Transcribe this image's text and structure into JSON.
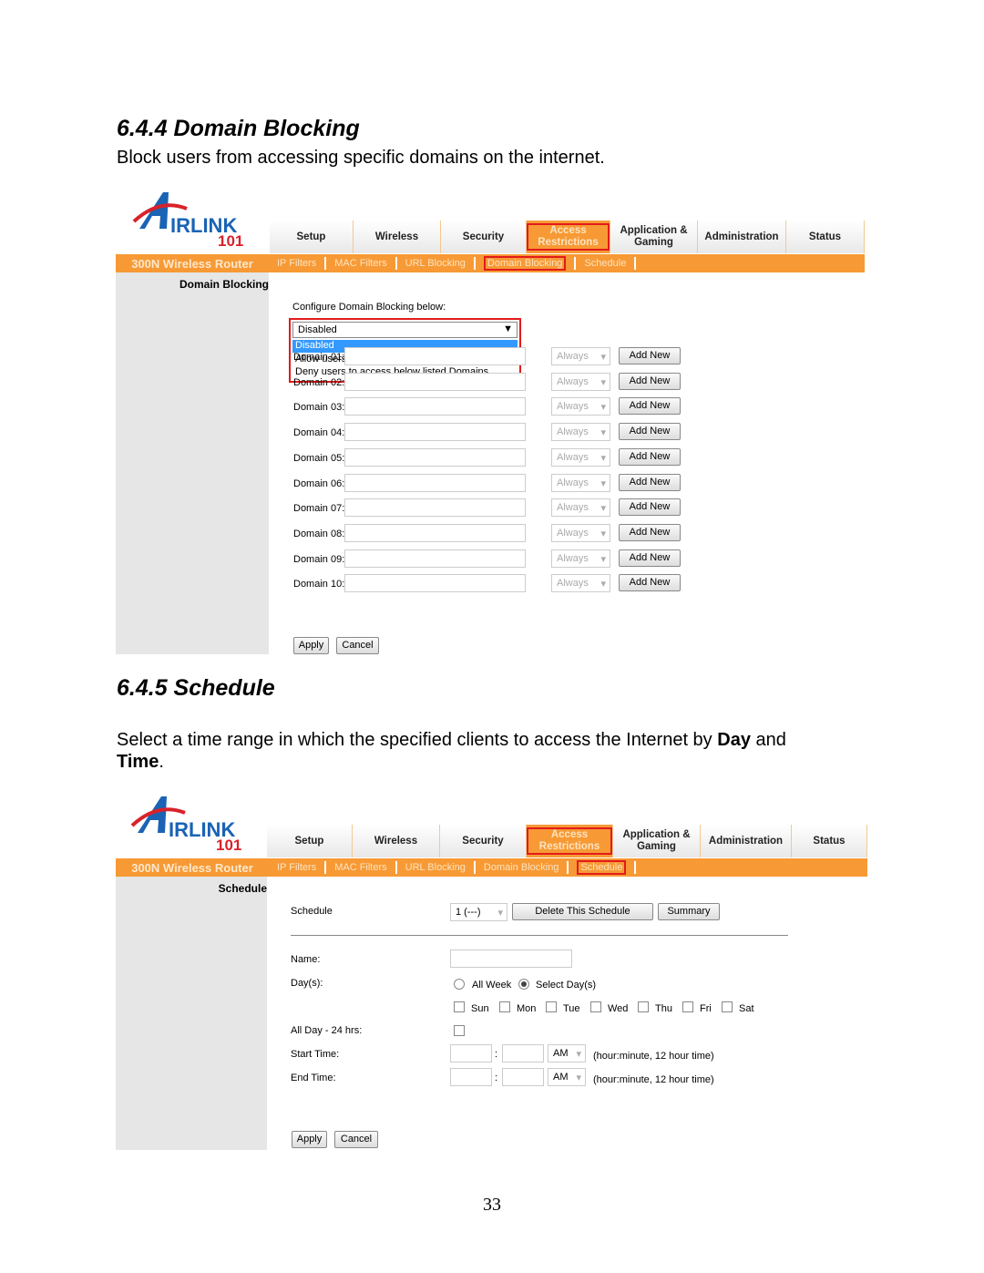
{
  "section1": {
    "title": "6.4.4 Domain Blocking",
    "description": "Block users from accessing specific domains on the internet."
  },
  "section2": {
    "title": "6.4.5 Schedule",
    "desc_a": "Select  a time range in which the specified clients to access the Internet by ",
    "desc_day": "Day",
    "desc_b": " and",
    "desc_time": "Time",
    "desc_c": "."
  },
  "logo": {
    "text": "AIRLINK 101"
  },
  "nav": {
    "tabs": [
      "Setup",
      "Wireless",
      "Security",
      "Access Restrictions",
      "Application & Gaming",
      "Administration",
      "Status"
    ],
    "active": "Access Restrictions",
    "brand": "300N Wireless Router",
    "subtabs": [
      "IP Filters",
      "MAC Filters",
      "URL Blocking",
      "Domain Blocking",
      "Schedule"
    ]
  },
  "domain": {
    "side_title": "Domain Blocking",
    "configure_label": "Configure Domain Blocking below:",
    "select_value": "Disabled",
    "options": [
      "Disabled",
      "Allow users to access below listed Domains",
      "Deny users to access below listed Domains"
    ],
    "rows": [
      "Domain 01:",
      "Domain 02:",
      "Domain 03:",
      "Domain 04:",
      "Domain 05:",
      "Domain 06:",
      "Domain 07:",
      "Domain 08:",
      "Domain 09:",
      "Domain 10:"
    ],
    "schedule_value": "Always",
    "add_new": "Add New",
    "apply": "Apply",
    "cancel": "Cancel"
  },
  "schedule": {
    "side_title": "Schedule",
    "schedule_label": "Schedule",
    "schedule_value": "1 (---)",
    "delete": "Delete This Schedule",
    "summary": "Summary",
    "name_label": "Name:",
    "days_label": "Day(s):",
    "all_week": "All Week",
    "select_days": "Select Day(s)",
    "days": [
      "Sun",
      "Mon",
      "Tue",
      "Wed",
      "Thu",
      "Fri",
      "Sat"
    ],
    "all_day_label": "All Day - 24 hrs:",
    "start_label": "Start Time:",
    "end_label": "End Time:",
    "ampm": "AM",
    "hint": "(hour:minute, 12 hour time)",
    "colon": ":",
    "apply": "Apply",
    "cancel": "Cancel"
  },
  "page_number": "33",
  "colors": {
    "orange": "#f79a35",
    "highlight": "#e21b1b",
    "select_blue": "#3399ff"
  }
}
